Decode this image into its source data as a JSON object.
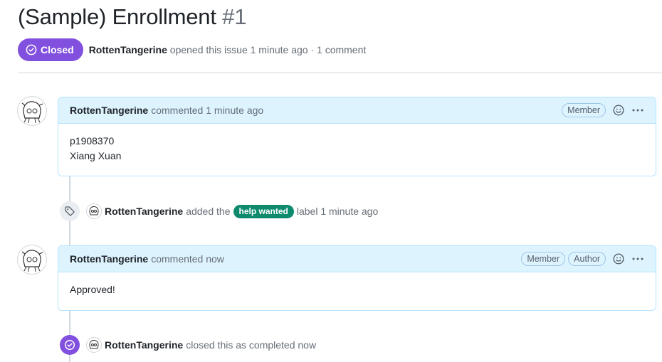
{
  "issue": {
    "title": "(Sample) Enrollment",
    "number": "#1",
    "state": "Closed",
    "author": "RottenTangerine",
    "opened_text": "opened this issue 1 minute ago · 1 comment"
  },
  "comments": [
    {
      "author": "RottenTangerine",
      "action": "commented 1 minute ago",
      "roles": [
        "Member"
      ],
      "body": [
        "p1908370",
        "Xiang Xuan"
      ]
    },
    {
      "author": "RottenTangerine",
      "action": "commented now",
      "roles": [
        "Member",
        "Author"
      ],
      "body": [
        "Approved!"
      ]
    }
  ],
  "events": {
    "label_added": {
      "actor": "RottenTangerine",
      "before": "added the",
      "label": "help wanted",
      "after": "label 1 minute ago"
    },
    "closed": {
      "actor": "RottenTangerine",
      "text": "closed this as completed now"
    }
  },
  "icons": {
    "state": "check-circle-icon",
    "reaction": "smiley-icon",
    "more": "kebab-horizontal-icon",
    "label_event": "tag-icon",
    "closed_event": "check-circle-icon"
  },
  "colors": {
    "closed": "#8250df",
    "comment_header": "#ddf4ff",
    "comment_border": "#b6e3ff",
    "label_help_wanted": "#0e8a6d",
    "muted_text": "#656d76"
  }
}
